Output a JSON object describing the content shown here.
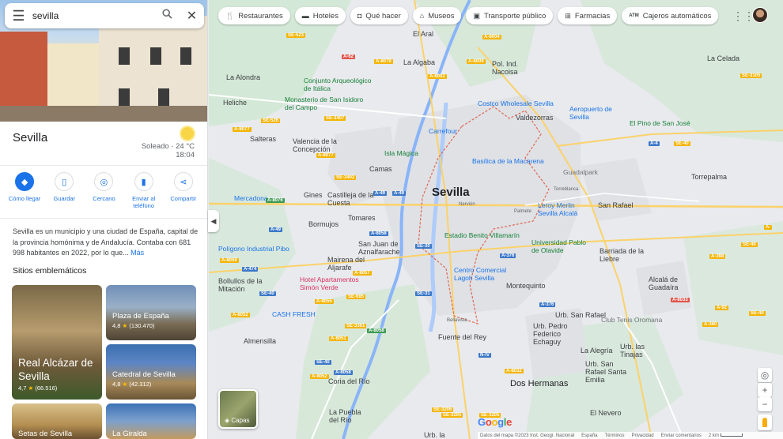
{
  "search": {
    "value": "sevilla"
  },
  "place": {
    "title": "Sevilla",
    "weather_condition": "Soleado · 24 °C",
    "weather_time": "18:04",
    "description": "Sevilla es un municipio y una ciudad de España, capital de la provincia homónima y de Andalucía. Contaba con 681 998 habitantes en 2022,  por lo que...",
    "more_label": "Más"
  },
  "actions": [
    {
      "label": "Cómo llegar",
      "icon": "directions-icon"
    },
    {
      "label": "Guardar",
      "icon": "bookmark-icon"
    },
    {
      "label": "Cercano",
      "icon": "nearby-icon"
    },
    {
      "label": "Enviar al teléfono",
      "icon": "send-to-phone-icon"
    },
    {
      "label": "Compartir",
      "icon": "share-icon"
    }
  ],
  "landmarks": {
    "title": "Sitios emblemáticos",
    "items": [
      {
        "name": "Real Alcázar de Sevilla",
        "rating": "4,7",
        "reviews": "(66.516)"
      },
      {
        "name": "Plaza de España",
        "rating": "4,8",
        "reviews": "(130.470)"
      },
      {
        "name": "Catedral de Sevilla",
        "rating": "4,8",
        "reviews": "(42.312)"
      },
      {
        "name": "Setas de Sevilla"
      },
      {
        "name": "La Giralda"
      }
    ]
  },
  "chips": [
    {
      "label": "Restaurantes",
      "icon": "restaurant-icon"
    },
    {
      "label": "Hoteles",
      "icon": "hotel-icon"
    },
    {
      "label": "Qué hacer",
      "icon": "camera-icon"
    },
    {
      "label": "Museos",
      "icon": "museum-icon"
    },
    {
      "label": "Transporte público",
      "icon": "transit-icon"
    },
    {
      "label": "Farmacias",
      "icon": "pharmacy-icon"
    },
    {
      "label": "Cajeros automáticos",
      "icon": "atm-icon"
    }
  ],
  "map": {
    "labels": [
      "Sevilla",
      "El Aral",
      "La Algaba",
      "Pol. Ind. Nacoisa",
      "La Celada",
      "La Alondra",
      "Conjunto Arqueológico de Itálica",
      "Monasterio de San Isidoro del Campo",
      "Costco Wholesale Sevilla",
      "Aeropuerto de Sevilla",
      "Heliche",
      "Valdezorras",
      "El Pino de San José",
      "Salteras",
      "Valencia de la Concepción",
      "Isla Mágica",
      "Carrefour",
      "Basílica de la Macarena",
      "Mercadona",
      "Guadalpark",
      "Torrepalma",
      "Camas",
      "Gines",
      "Castilleja de la Cuesta",
      "Torreblanca",
      "Leroy Merlin Sevilla Alcalá",
      "San Rafael",
      "Bormujos",
      "Tomares",
      "Nervión",
      "Palmete",
      "Estadio Benito Villamarín",
      "Universidad Pablo de Olavide",
      "Polígono Industrial Pibo",
      "San Juan de Aznalfarache",
      "Mairena del Aljarafe",
      "Barriada de la Liebre",
      "Centro Comercial Lagoh Sevilla",
      "Montequinto",
      "Bollullos de la Mitación",
      "Hotel Apartamentos Simón Verde",
      "Alcalá de Guadaíra",
      "CASH FRESH",
      "Club Tenis Oromana",
      "Almensilla",
      "Bellavista",
      "Urb. San Rafael",
      "Urb. Pedro Federico Echaguy",
      "La Alegría",
      "Urb. las Tinajas",
      "Fuente del Rey",
      "Coria del Río",
      "Dos Hermanas",
      "Urb. San Rafael Santa Emilia",
      "El Nevero",
      "La Puebla del Río",
      "Urb. la"
    ]
  },
  "map_controls": {
    "layers_label": "Capas",
    "zoom_in": "+",
    "zoom_out": "−"
  },
  "footer": {
    "google": "Google",
    "items": [
      "Datos del mapa ©2023 Inst. Geogr. Nacional",
      "España",
      "Términos",
      "Privacidad",
      "Enviar comentarios",
      "2 km"
    ]
  }
}
